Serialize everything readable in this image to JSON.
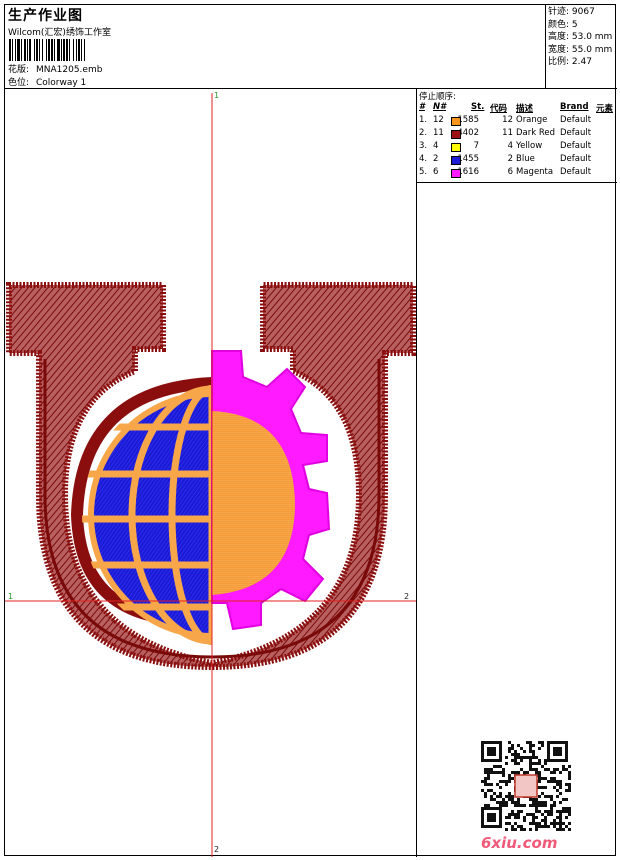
{
  "header": {
    "title": "生产作业图",
    "subtitle": "Wilcom(汇宏)绣饰工作室",
    "pattern_label": "花版:",
    "pattern_value": "MNA1205.emb",
    "colorway_label": "色位:",
    "colorway_value": "Colorway 1"
  },
  "stats": {
    "stitches": "针迹: 9067",
    "colors": "颜色: 5",
    "height": "高度: 53.0 mm",
    "width": "宽度: 55.0 mm",
    "ratio": "比例: 2.47"
  },
  "sequence": {
    "title": "停止顺序:",
    "headers": {
      "idx": "#",
      "n": "N#",
      "st": "St.",
      "code": "代码",
      "desc": "描述",
      "brand": "Brand",
      "elem": "元素"
    },
    "rows": [
      {
        "idx": "1.",
        "n": "12",
        "color": "#f7941d",
        "st": "1585",
        "code": "12",
        "desc": "Orange",
        "brand": "Default"
      },
      {
        "idx": "2.",
        "n": "11",
        "color": "#9b1010",
        "st": "4402",
        "code": "11",
        "desc": "Dark Red",
        "brand": "Default"
      },
      {
        "idx": "3.",
        "n": "4",
        "color": "#ffff00",
        "st": "7",
        "code": "4",
        "desc": "Yellow",
        "brand": "Default"
      },
      {
        "idx": "4.",
        "n": "2",
        "color": "#1b1bd6",
        "st": "1455",
        "code": "2",
        "desc": "Blue",
        "brand": "Default"
      },
      {
        "idx": "5.",
        "n": "6",
        "color": "#ff1aff",
        "st": "1616",
        "code": "6",
        "desc": "Magenta",
        "brand": "Default"
      }
    ]
  },
  "axes": {
    "v_top": "1",
    "v_bottom": "2",
    "h_left": "1",
    "h_right": "2"
  },
  "watermark": "6xiu.com",
  "colors": {
    "dark_red": "#9b1010",
    "blue": "#1b1bd6",
    "orange": "#f7a64a",
    "magenta": "#ff1aff",
    "axis": "#e02020"
  }
}
